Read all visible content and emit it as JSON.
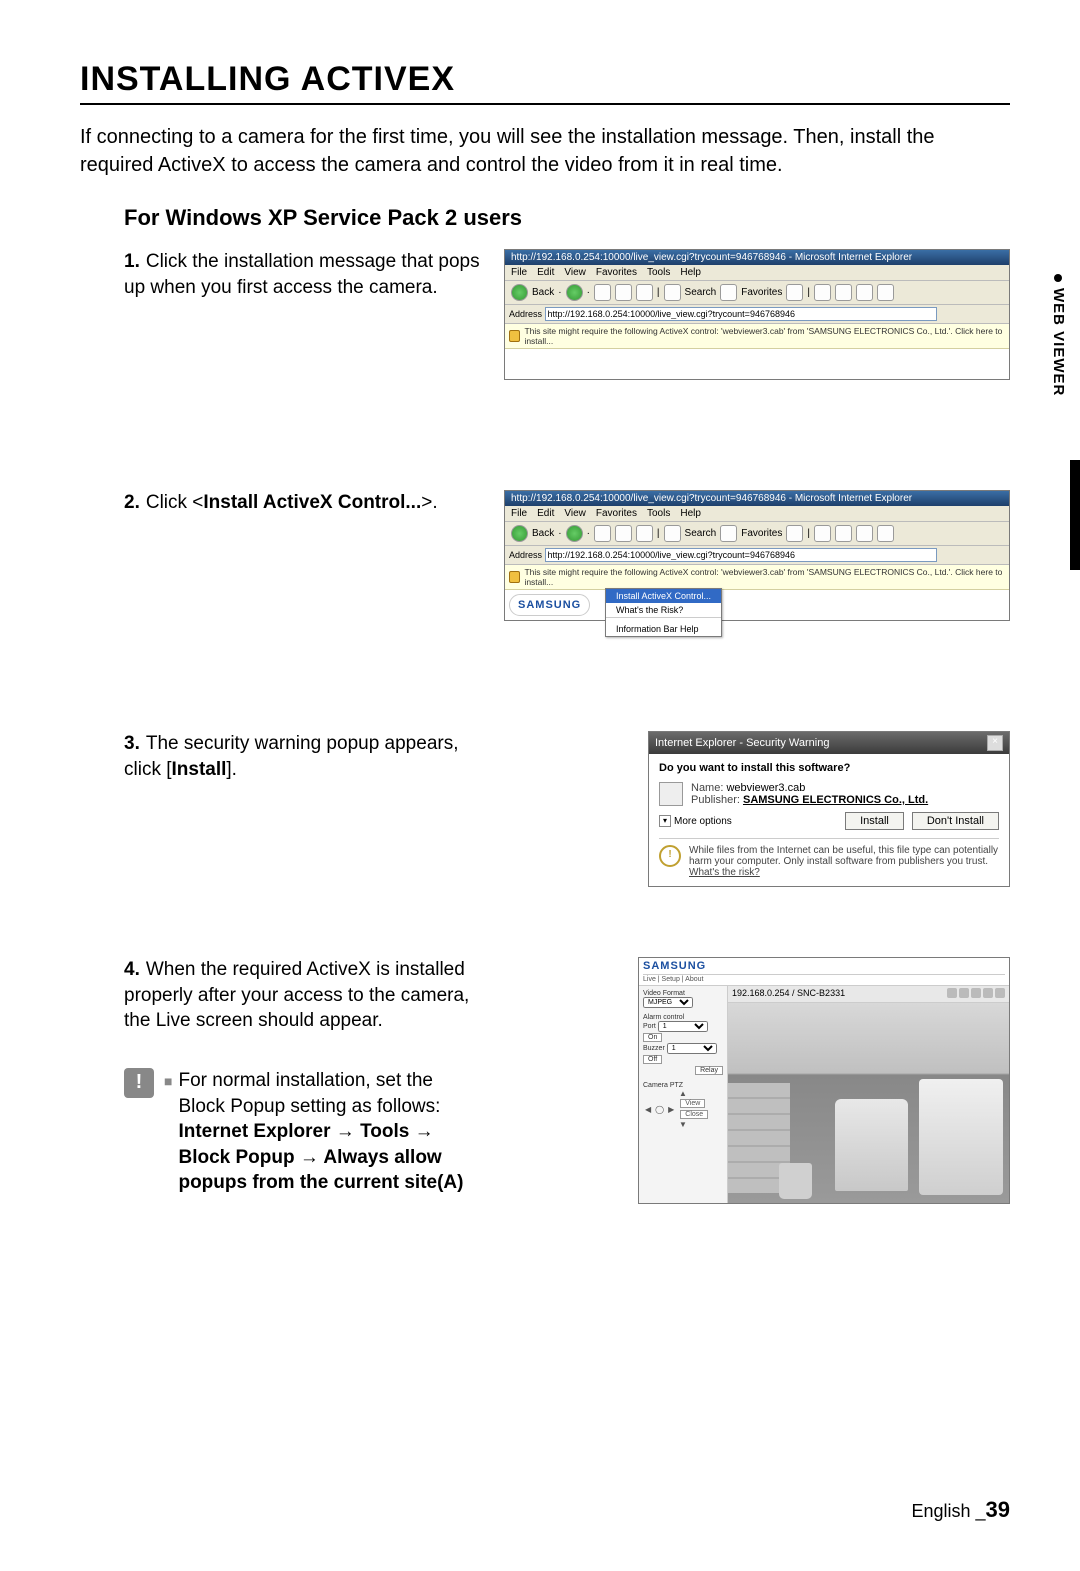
{
  "page": {
    "title": "INSTALLING ACTIVEX",
    "intro": "If connecting to a camera for the first time, you will see the installation message. Then, install the required ActiveX to access the camera and control the video from it in real time.",
    "subheading": "For Windows XP Service Pack 2 users",
    "footer_lang": "English",
    "footer_sep": " _",
    "footer_page": "39",
    "side_tab": "WEB VIEWER"
  },
  "steps": [
    {
      "num": "1.",
      "text": "Click the installation message that pops up when you first access the camera."
    },
    {
      "num": "2.",
      "text_prefix": "Click <",
      "bold": "Install ActiveX Control...",
      "text_suffix": ">."
    },
    {
      "num": "3.",
      "text_prefix": "The security warning popup appears, click [",
      "bold": "Install",
      "text_suffix": "]."
    },
    {
      "num": "4.",
      "text": "When the required ActiveX is installed properly after your access to the camera, the Live screen should appear."
    }
  ],
  "note": {
    "icon": "!",
    "bullet": "■",
    "line1": "For normal installation, set the Block Popup setting as follows:",
    "line2": "Internet Explorer → Tools → Block Popup → Always allow popups from the current site(A)"
  },
  "ie_common": {
    "title": "http://192.168.0.254:10000/live_view.cgi?trycount=946768946 - Microsoft Internet Explorer",
    "menu": [
      "File",
      "Edit",
      "View",
      "Favorites",
      "Tools",
      "Help"
    ],
    "back": "Back",
    "search": "Search",
    "fav": "Favorites",
    "addr_label": "Address",
    "addr1": "http://192.168.0.254:10000/live_view.cgi?trycount=946768946",
    "addr2": "http://192.168.0.254:10000/live_view.cgi?trycount=946768946",
    "infobar": "This site might require the following ActiveX control: 'webviewer3.cab' from 'SAMSUNG ELECTRONICS Co., Ltd.'. Click here to install...",
    "ctx": {
      "install": "Install ActiveX Control...",
      "risk": "What's the Risk?",
      "info": "Information Bar Help"
    },
    "samsung": "SAMSUNG"
  },
  "sec": {
    "title": "Internet Explorer - Security Warning",
    "question": "Do you want to install this software?",
    "name_label": "Name:",
    "name_value": "webviewer3.cab",
    "pub_label": "Publisher:",
    "pub_value": "SAMSUNG ELECTRONICS Co., Ltd.",
    "more": "More options",
    "install_btn": "Install",
    "dont_btn": "Don't Install",
    "foot": "While files from the Internet can be useful, this file type can potentially harm your computer. Only install software from publishers you trust. ",
    "risk": "What's the risk?"
  },
  "live": {
    "logo": "SAMSUNG",
    "tabs": "Live | Setup | About",
    "addr": "192.168.0.254 / SNC-B2331",
    "format_label": "Video Format",
    "format_value": "MJPEG",
    "alarm_label": "Alarm control",
    "port": "Port",
    "on": "On",
    "off": "Off",
    "buzzer": "Buzzer",
    "relay": "Relay",
    "camera_ptz": "Camera PTZ",
    "view": "View",
    "close": "Close"
  }
}
